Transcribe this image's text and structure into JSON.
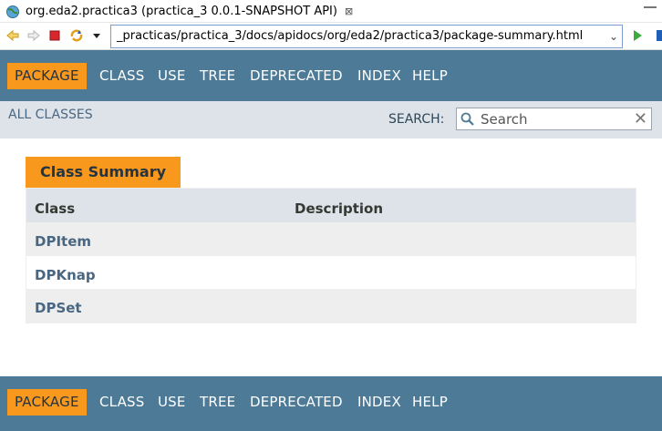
{
  "tab": {
    "title": "org.eda2.practica3 (practica_3 0.0.1-SNAPSHOT API)",
    "close": "⊠"
  },
  "toolbar": {
    "url": "_practicas/practica_3/docs/apidocs/org/eda2/practica3/package-summary.html",
    "icons": [
      "back-icon",
      "forward-icon",
      "stop-icon",
      "refresh-icon",
      "menu-dropdown-icon",
      "go-icon",
      "bookmark-icon"
    ]
  },
  "nav": {
    "items": [
      "PACKAGE",
      "CLASS",
      "USE",
      "TREE",
      "DEPRECATED",
      "INDEX",
      "HELP"
    ],
    "active": "PACKAGE"
  },
  "subnav": {
    "all_classes": "ALL CLASSES",
    "search_label": "SEARCH:",
    "search_placeholder": "Search"
  },
  "summary": {
    "caption": "Class Summary",
    "headers": [
      "Class",
      "Description"
    ],
    "rows": [
      "DPItem",
      "DPKnap",
      "DPSet"
    ]
  },
  "colors": {
    "nav_bg": "#4d7a97",
    "accent": "#f8981d",
    "subnav_bg": "#dee3e9",
    "link": "#4a6782"
  }
}
